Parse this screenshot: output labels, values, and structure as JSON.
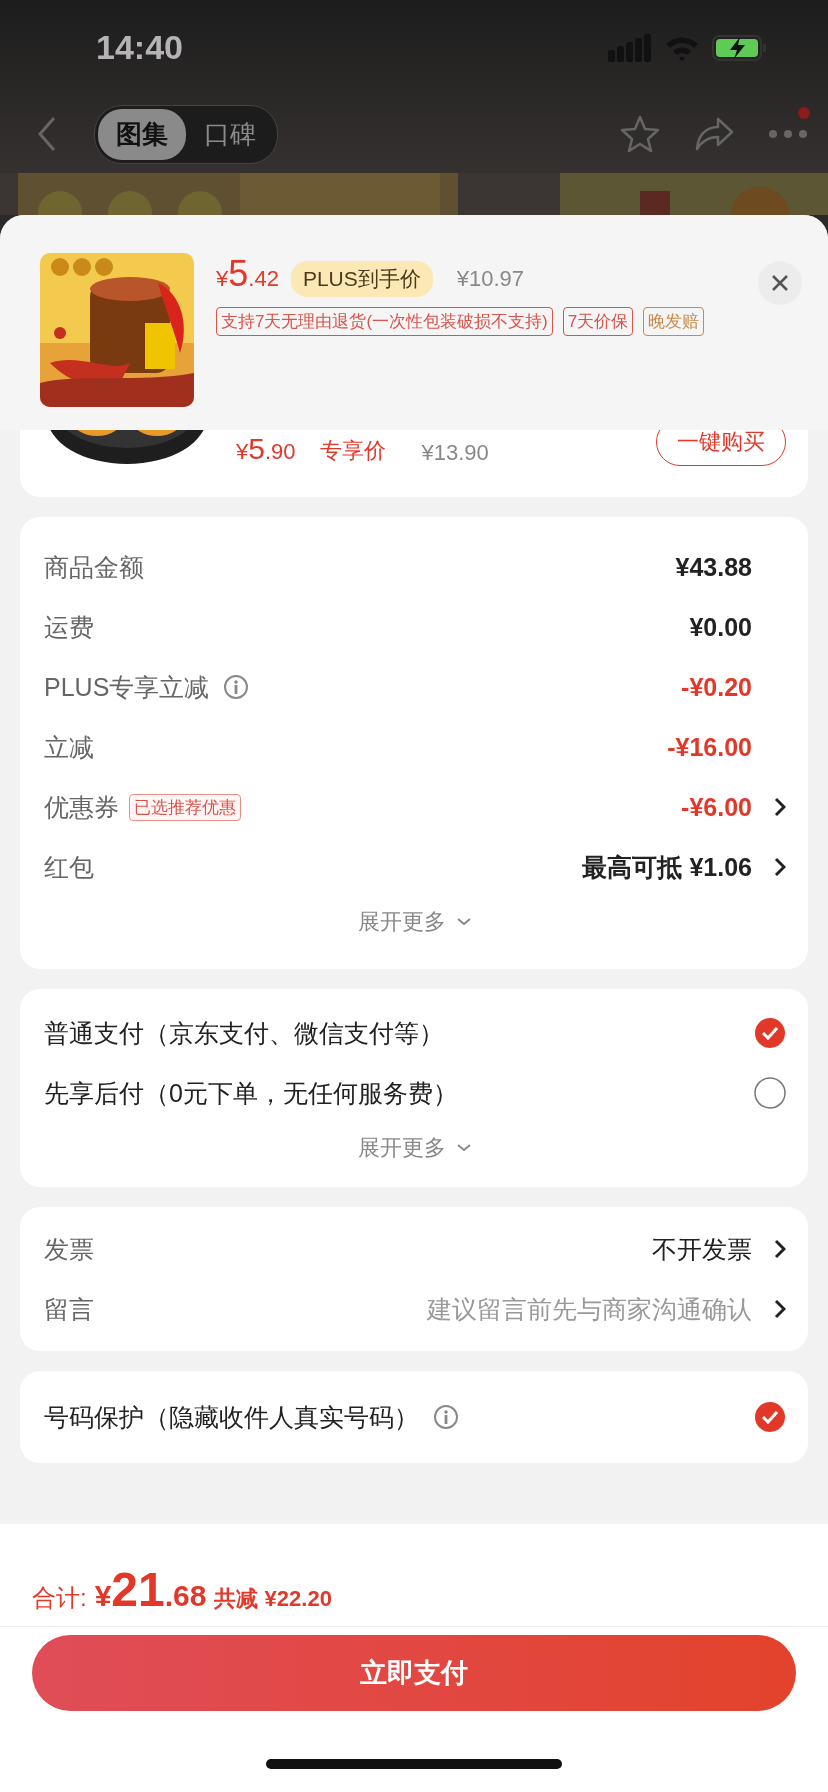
{
  "status_bar": {
    "time": "14:40"
  },
  "nav": {
    "tabs": [
      {
        "label": "图集",
        "selected": true
      },
      {
        "label": "口碑",
        "selected": false
      }
    ],
    "more_badge": true
  },
  "product": {
    "currency": "¥",
    "price_int": "5",
    "price_dec": ".42",
    "price_label": "PLUS到手价",
    "original_price": "¥10.97",
    "tags": [
      {
        "text": "支持7天无理由退货(一次性包装破损不支持)",
        "color": "#d9534a"
      },
      {
        "text": "7天价保",
        "color": "#d9534a"
      },
      {
        "text": "晚发赔",
        "color": "#c8894a"
      }
    ]
  },
  "partial_item": {
    "currency": "¥",
    "price_int": "5",
    "price_dec": ".90",
    "price_label": "专享价",
    "original_price": "¥13.90",
    "button": "一键购买"
  },
  "charges": {
    "rows": [
      {
        "label": "商品金额",
        "value": "¥43.88",
        "kind": "plain",
        "info": false,
        "link": false
      },
      {
        "label": "运费",
        "value": "¥0.00",
        "kind": "plain",
        "info": false,
        "link": false
      },
      {
        "label": "PLUS专享立减",
        "value": "-¥0.20",
        "kind": "discount",
        "info": true,
        "link": false
      },
      {
        "label": "立减",
        "value": "-¥16.00",
        "kind": "discount",
        "info": false,
        "link": false
      },
      {
        "label": "优惠券",
        "tag": "已选推荐优惠",
        "value": "-¥6.00",
        "kind": "discount",
        "info": false,
        "link": true
      },
      {
        "label": "红包",
        "value": "最高可抵 ¥1.06",
        "kind": "plain",
        "info": false,
        "link": true
      }
    ],
    "expand": "展开更多"
  },
  "payment": {
    "options": [
      {
        "label": "普通支付（京东支付、微信支付等）",
        "selected": true
      },
      {
        "label": "先享后付（0元下单，无任何服务费）",
        "selected": false
      }
    ],
    "expand": "展开更多"
  },
  "extras": {
    "rows": [
      {
        "label": "发票",
        "value": "不开发票",
        "kind": "value"
      },
      {
        "label": "留言",
        "value": "建议留言前先与商家沟通确认",
        "kind": "hint"
      }
    ]
  },
  "phone_protection": {
    "label": "号码保护（隐藏收件人真实号码）",
    "checked": true
  },
  "footer": {
    "total_label": "合计:",
    "currency": "¥",
    "total_int": "21",
    "total_dec": ".68",
    "saved": "共减 ¥22.20",
    "pay_button": "立即支付"
  }
}
